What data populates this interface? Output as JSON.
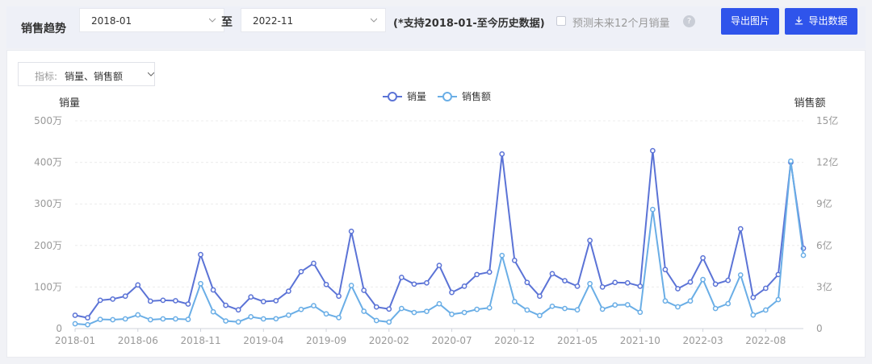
{
  "toolbar": {
    "title": "销售趋势",
    "start_month": "2018-01",
    "to_label": "至",
    "end_month": "2022-11",
    "range_hint": "(*支持2018-01-至今历史数据)",
    "forecast_label": "预测未来12个月销量",
    "help_glyph": "?",
    "export_image_label": "导出图片",
    "export_data_label": "导出数据",
    "export_data_icon": "download-icon"
  },
  "metric_select": {
    "label": "指标:",
    "value": "销量、销售额"
  },
  "colors": {
    "sales_volume": "#5b73d6",
    "sales_amount": "#6aaee6",
    "button": "#2f54eb"
  },
  "chart_data": {
    "type": "line",
    "x": [
      "2018-01",
      "2018-02",
      "2018-03",
      "2018-04",
      "2018-05",
      "2018-06",
      "2018-07",
      "2018-08",
      "2018-09",
      "2018-10",
      "2018-11",
      "2018-12",
      "2019-01",
      "2019-02",
      "2019-03",
      "2019-04",
      "2019-05",
      "2019-06",
      "2019-07",
      "2019-08",
      "2019-09",
      "2019-10",
      "2019-11",
      "2019-12",
      "2020-01",
      "2020-02",
      "2020-03",
      "2020-04",
      "2020-05",
      "2020-06",
      "2020-07",
      "2020-08",
      "2020-09",
      "2020-10",
      "2020-11",
      "2020-12",
      "2021-01",
      "2021-02",
      "2021-03",
      "2021-04",
      "2021-05",
      "2021-06",
      "2021-07",
      "2021-08",
      "2021-09",
      "2021-10",
      "2021-11",
      "2021-12",
      "2022-01",
      "2022-02",
      "2022-03",
      "2022-04",
      "2022-05",
      "2022-06",
      "2022-07",
      "2022-08",
      "2022-09",
      "2022-10",
      "2022-11"
    ],
    "x_ticks": [
      "2018-01",
      "2018-06",
      "2018-11",
      "2019-04",
      "2019-09",
      "2020-02",
      "2020-07",
      "2020-12",
      "2021-05",
      "2021-10",
      "2022-03",
      "2022-08"
    ],
    "series": [
      {
        "name": "销量",
        "axis": "left",
        "values": [
          32,
          26,
          68,
          71,
          78,
          105,
          66,
          68,
          67,
          59,
          178,
          93,
          56,
          45,
          76,
          65,
          67,
          90,
          137,
          157,
          106,
          78,
          234,
          92,
          52,
          47,
          123,
          107,
          110,
          152,
          87,
          102,
          130,
          136,
          420,
          164,
          111,
          78,
          132,
          115,
          102,
          212,
          100,
          111,
          110,
          102,
          428,
          142,
          96,
          112,
          170,
          107,
          116,
          240,
          75,
          97,
          130,
          400,
          193
        ]
      },
      {
        "name": "销售额",
        "axis": "right",
        "values": [
          0.35,
          0.28,
          0.66,
          0.64,
          0.7,
          0.99,
          0.64,
          0.7,
          0.7,
          0.66,
          3.24,
          1.21,
          0.55,
          0.48,
          0.85,
          0.7,
          0.71,
          0.97,
          1.38,
          1.65,
          1.06,
          0.79,
          3.11,
          1.25,
          0.58,
          0.47,
          1.45,
          1.16,
          1.24,
          1.79,
          1.03,
          1.16,
          1.39,
          1.5,
          5.28,
          1.95,
          1.34,
          0.94,
          1.61,
          1.45,
          1.35,
          3.24,
          1.4,
          1.7,
          1.72,
          1.18,
          8.6,
          1.99,
          1.57,
          1.99,
          3.54,
          1.45,
          1.8,
          3.87,
          0.98,
          1.34,
          2.09,
          12.09,
          5.29
        ]
      }
    ],
    "yleft": {
      "label": "销量",
      "ticks": [
        "0",
        "100万",
        "200万",
        "300万",
        "400万",
        "500万"
      ],
      "ylim": [
        0,
        500
      ]
    },
    "yright": {
      "label": "销售额",
      "ticks": [
        "0",
        "3亿",
        "6亿",
        "9亿",
        "12亿",
        "15亿"
      ],
      "ylim": [
        0,
        15
      ]
    },
    "grid": true,
    "legend": "top-center"
  }
}
